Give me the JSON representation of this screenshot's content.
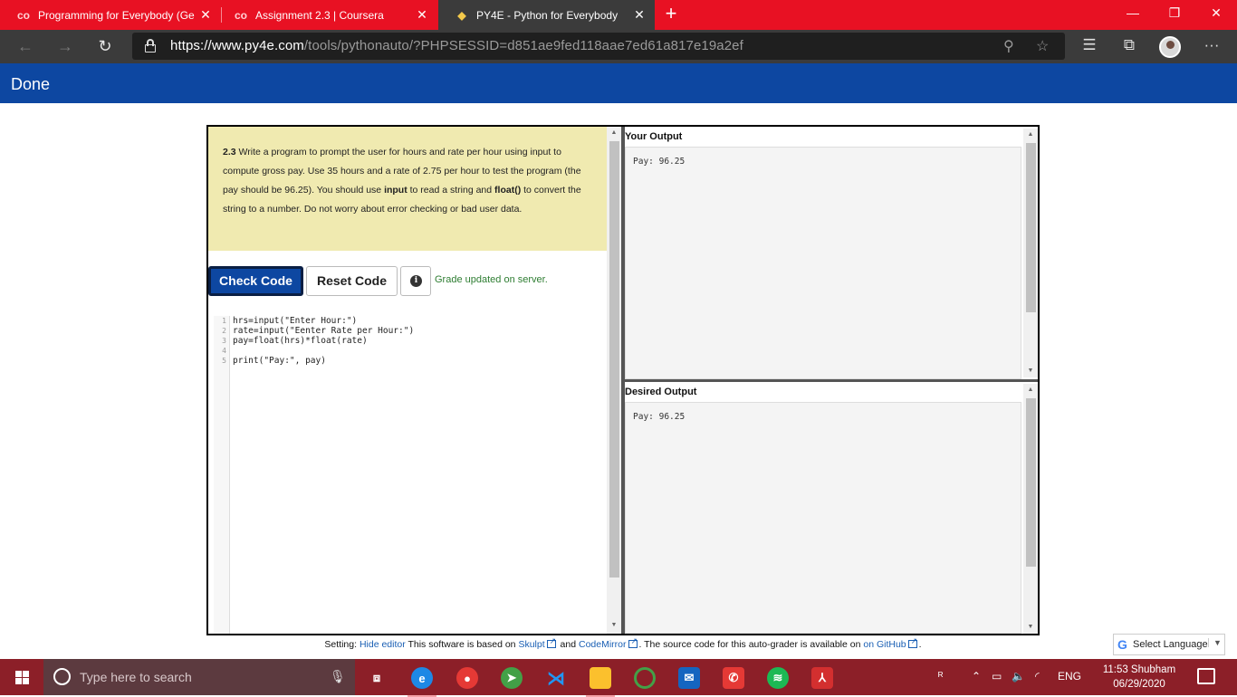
{
  "browser": {
    "tabs": [
      {
        "title": "Programming for Everybody (Ge",
        "icon": "coursera-icon",
        "active": false
      },
      {
        "title": "Assignment 2.3 | Coursera",
        "icon": "coursera-icon",
        "active": false
      },
      {
        "title": "PY4E - Python for Everybody",
        "icon": "python-icon",
        "active": true
      }
    ],
    "tab_close_glyph": "✕",
    "new_tab_glyph": "+",
    "url_host": "https://www.py4e.com",
    "url_path": "/tools/pythonauto/?PHPSESSID=d851ae9fed118aae7ed61a817e19a2ef"
  },
  "page": {
    "header_title": "Done"
  },
  "problem": {
    "number": "2.3",
    "text_1": " Write a program to prompt the user for hours and rate per hour using input to compute gross pay. Use 35 hours and a rate of 2.75 per hour to test the program (the pay should be 96.25). You should use ",
    "kw_input": "input",
    "text_2": " to read a string and ",
    "kw_float": "float()",
    "text_3": " to convert the string to a number. Do not worry about error checking or bad user data."
  },
  "controls": {
    "check_label": "Check Code",
    "reset_label": "Reset Code",
    "info_glyph": "i",
    "status": "Grade updated on server."
  },
  "editor": {
    "line_numbers": [
      "1",
      "2",
      "3",
      "4",
      "5"
    ],
    "lines": [
      "hrs=input(\"Enter Hour:\")",
      "rate=input(\"Eenter Rate per Hour:\")",
      "pay=float(hrs)*float(rate)",
      "",
      "print(\"Pay:\", pay)"
    ]
  },
  "output": {
    "your_label": "Your Output",
    "your_value": "Pay: 96.25",
    "desired_label": "Desired Output",
    "desired_value": "Pay: 96.25"
  },
  "footer": {
    "setting": "Setting: ",
    "hide_editor": "Hide editor",
    "based_on": " This software is based on ",
    "skulpt": "Skulpt",
    "and": " and ",
    "codemirror": "CodeMirror",
    "source": ". The source code for this auto-grader is available on ",
    "github": "on GitHub",
    "end": "."
  },
  "translate": {
    "label": "Select Language"
  },
  "taskbar": {
    "search_placeholder": "Type here to search",
    "lang": "ENG",
    "time": "11:53 Shubham",
    "date": "06/29/2020"
  },
  "colors": {
    "tab_strip": "#e81123",
    "header_bar": "#0d47a1",
    "instructions_bg": "#f0eab0",
    "check_button": "#0d47a1",
    "status_green": "#2e7d32",
    "taskbar": "#8c1f28"
  }
}
